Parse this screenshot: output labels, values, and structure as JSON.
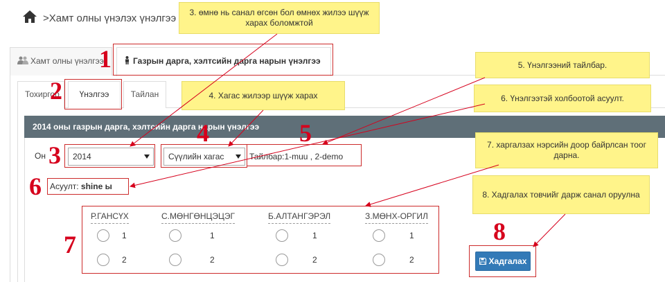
{
  "header": {
    "title": ">Хамт олны үнэлэх үнэлгээ"
  },
  "outer_tabs": [
    {
      "label": "Хамт олны үнэлгээ"
    },
    {
      "label": "Газрын дарга, хэлтсийн дарга нарын үнэлгээ"
    }
  ],
  "inner_tabs": [
    {
      "label": "Тохиргоо"
    },
    {
      "label": "Үнэлгээ"
    },
    {
      "label": "Тайлан"
    }
  ],
  "form": {
    "header": "2014 оны  газрын дарга, хэлтсийн дарга нарын үнэлгээ",
    "year_label": "Он",
    "year_value": "2014",
    "half_value": "Сүүлийн хагас",
    "description": "Тайлбар:1-muu , 2-demo",
    "question_label": "Асуулт:",
    "question_text": "shine ы",
    "candidates": [
      {
        "name": "Р.ГАНСҮХ",
        "options": [
          "1",
          "2"
        ]
      },
      {
        "name": "С.МӨНГӨНЦЭЦЭГ",
        "options": [
          "1",
          "2"
        ]
      },
      {
        "name": "Б.АЛТАНГЭРЭЛ",
        "options": [
          "1",
          "2"
        ]
      },
      {
        "name": "З.МӨНХ-ОРГИЛ",
        "options": [
          "1",
          "2"
        ]
      }
    ],
    "save_label": "Хадгалах"
  },
  "annotations": {
    "numbers": [
      "1",
      "2",
      "3",
      "4",
      "5",
      "6",
      "7",
      "8"
    ],
    "notes": {
      "n3": "3. өмнө нь санал өгсөн бол өмнөх жилээ шүүж харах боломжтой",
      "n4": "4. Хагас жилээр шүүж харах",
      "n5": "5. Үнэлгээний тайлбар.",
      "n6": "6. Үнэлгээтэй холбоотой асуулт.",
      "n7": "7. харгалзах нэрсийн доор байрлсан тоог дарна.",
      "n8": "8. Хадгалах товчийг дарж санал оруулна"
    }
  },
  "colors": {
    "header_bar": "#5f6f78",
    "primary_button": "#337ab7",
    "annotation_red": "#d6001c",
    "note_yellow": "#fff48a"
  },
  "icons": {
    "home": "home-icon",
    "users": "users-icon",
    "person": "person-icon",
    "save": "floppy-disk-icon",
    "dropdown": "caret-down-icon"
  }
}
